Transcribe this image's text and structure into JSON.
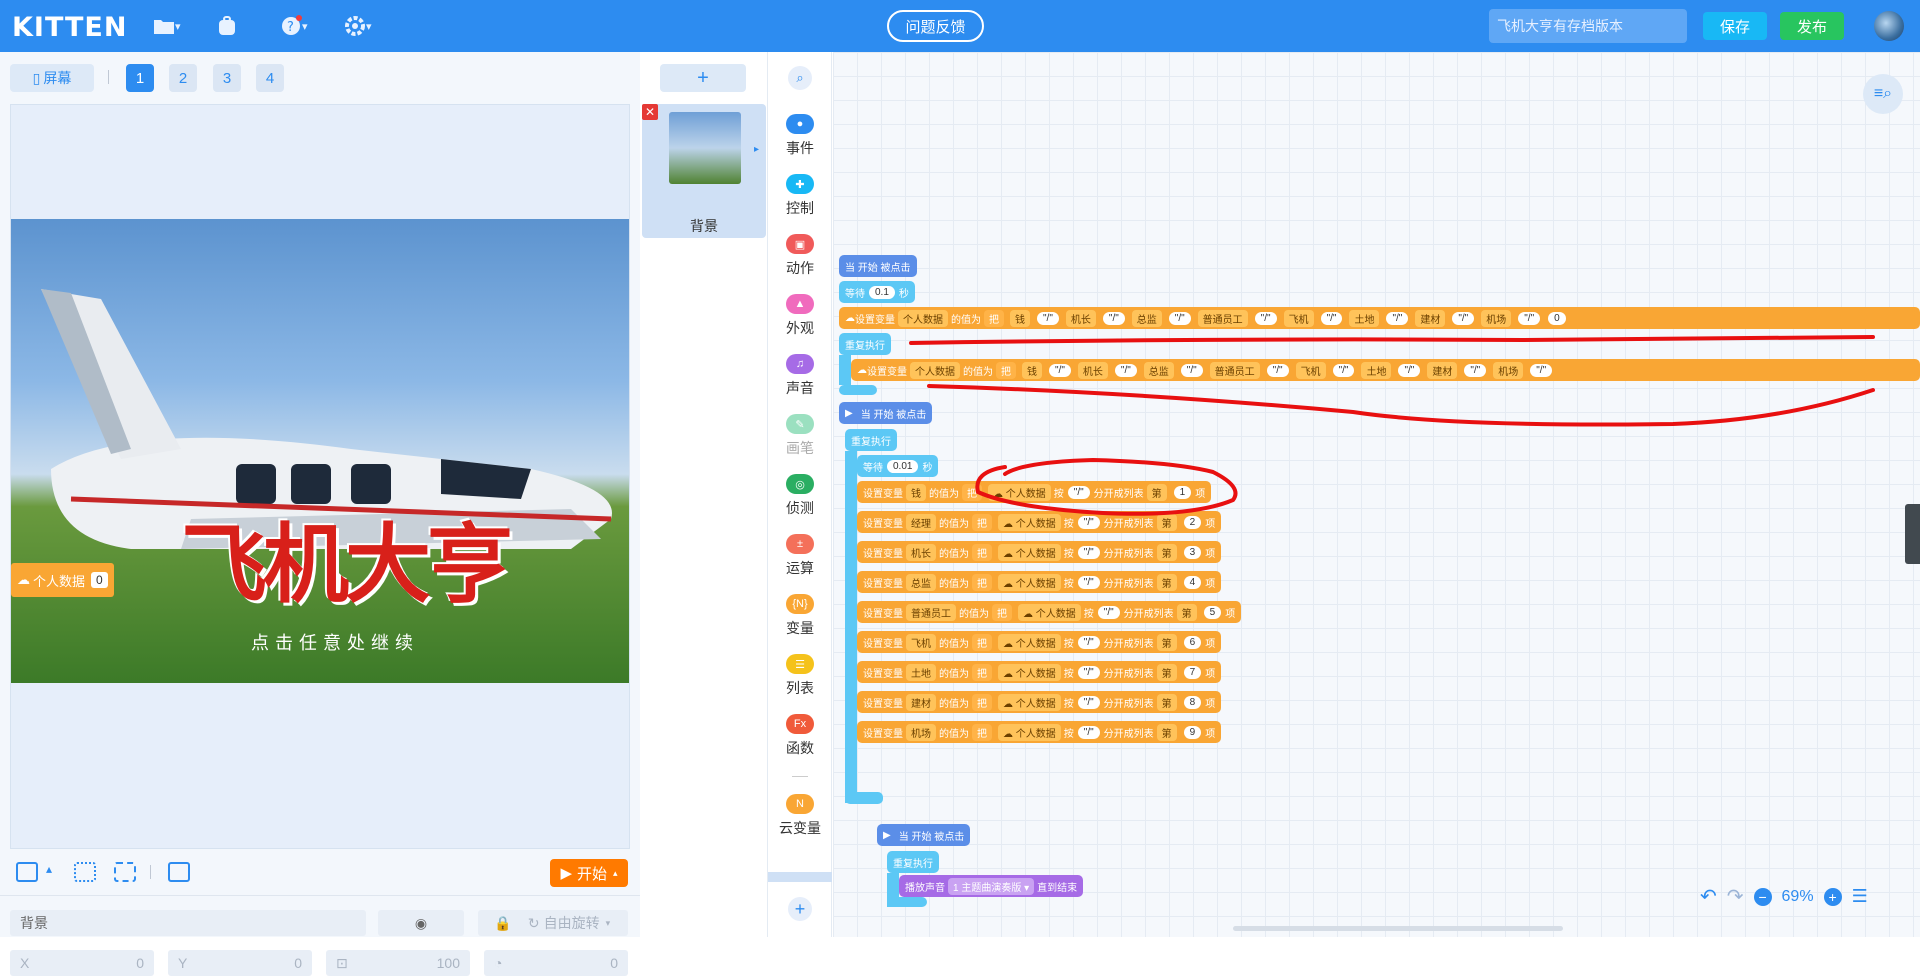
{
  "app": {
    "logo": "KITTEN"
  },
  "header": {
    "feedback_label": "问题反馈",
    "project_name_placeholder": "飞机大亨有存档版本",
    "save_label": "保存",
    "publish_label": "发布"
  },
  "stage": {
    "screen_label": "屏幕",
    "pages": [
      "1",
      "2",
      "3",
      "4"
    ],
    "active_page": "1",
    "game_title": "飞机大亨",
    "game_hint": "点击任意处继续",
    "watch_label": "个人数据",
    "watch_value": "0",
    "start_label": "开始"
  },
  "props": {
    "name_value": "背景",
    "rotate_label": "自由旋转",
    "x_label": "X",
    "x_value": "0",
    "y_label": "Y",
    "y_value": "0",
    "size_value": "100",
    "dir_value": "0"
  },
  "sprites": [
    {
      "name": "背景"
    }
  ],
  "categories": [
    {
      "label": "事件",
      "color": "#2d8cf0"
    },
    {
      "label": "控制",
      "color": "#18b8f5"
    },
    {
      "label": "动作",
      "color": "#f05a5a"
    },
    {
      "label": "外观",
      "color": "#f06bbd"
    },
    {
      "label": "声音",
      "color": "#a66be6"
    },
    {
      "label": "画笔",
      "color": "#9be0c0"
    },
    {
      "label": "侦测",
      "color": "#2aae62"
    },
    {
      "label": "运算",
      "color": "#f4705a"
    },
    {
      "label": "变量",
      "color": "#f9a634"
    },
    {
      "label": "列表",
      "color": "#f5c21b"
    },
    {
      "label": "函数",
      "color": "#f05a3a"
    },
    {
      "label": "云变量",
      "color": "#f9a634"
    }
  ],
  "code": {
    "hat1": "当 开始 被点击",
    "wait1_prefix": "等待",
    "wait1_value": "0.1",
    "wait1_unit": "秒",
    "set_data_label": "设置变量",
    "data_var": "个人数据",
    "value_is": "的值为",
    "join_label": "把",
    "joined_items": [
      "钱",
      "\"/\"",
      "机长",
      "\"/\"",
      "总监",
      "\"/\"",
      "普通员工",
      "\"/\"",
      "飞机",
      "\"/\"",
      "土地",
      "\"/\"",
      "建材",
      "\"/\"",
      "机场",
      "\"/\"",
      "0"
    ],
    "forever": "重复执行",
    "hat2": "当 开始 被点击",
    "wait2_value": "0.01",
    "split_by": "按",
    "split_sep": "\"/\"",
    "split_label": "分开成列表",
    "index_prefix": "第",
    "index_suffix": "项",
    "split_rows": [
      {
        "var": "钱",
        "index": "1"
      },
      {
        "var": "经理",
        "index": "2"
      },
      {
        "var": "机长",
        "index": "3"
      },
      {
        "var": "总监",
        "index": "4"
      },
      {
        "var": "普通员工",
        "index": "5"
      },
      {
        "var": "飞机",
        "index": "6"
      },
      {
        "var": "土地",
        "index": "7"
      },
      {
        "var": "建材",
        "index": "8"
      },
      {
        "var": "机场",
        "index": "9"
      }
    ],
    "hat3": "当 开始 被点击",
    "play_sound": "播放声音",
    "sound_name": "主题曲演奏版",
    "until_end": "直到结束"
  },
  "zoom": {
    "value": "69%"
  }
}
